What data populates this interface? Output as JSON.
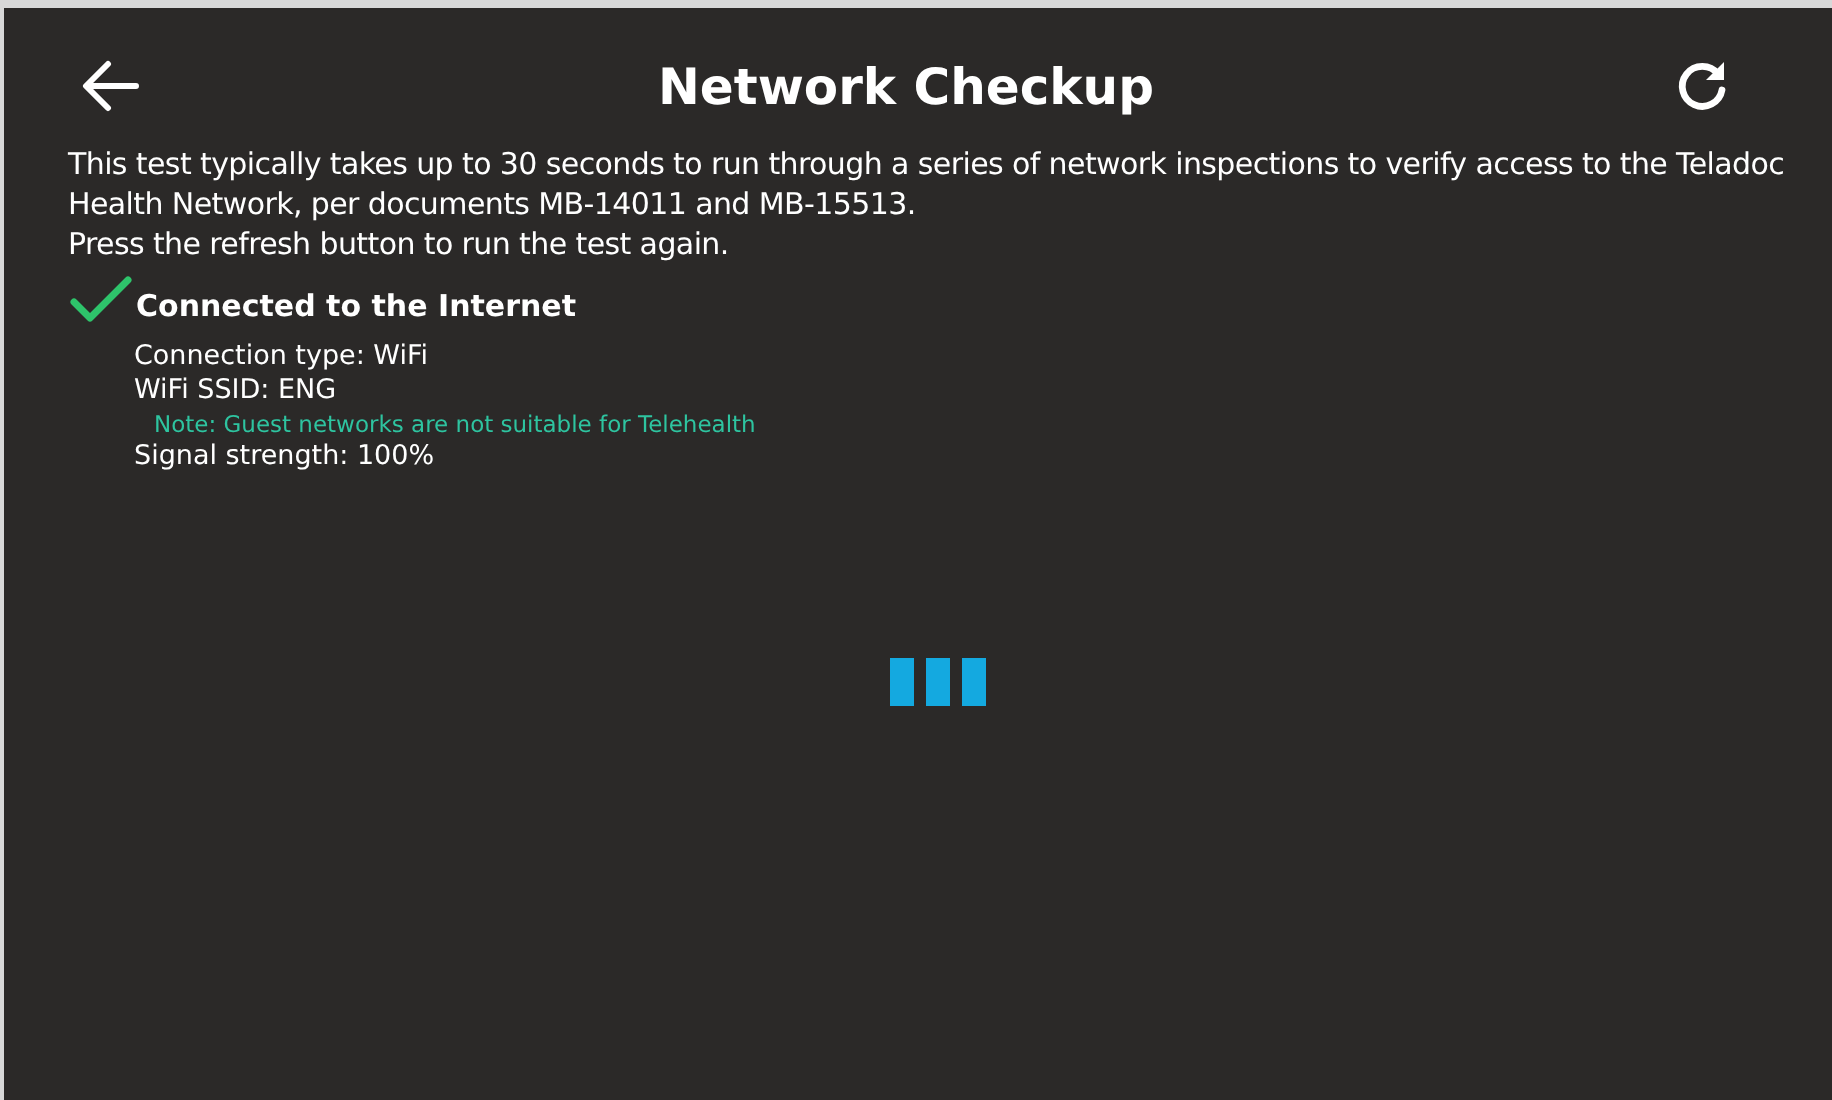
{
  "header": {
    "title": "Network Checkup"
  },
  "intro": [
    "This test typically takes up to 30 seconds to run through a series of network inspections to verify access to the Teladoc Health Network, per documents MB-14011 and MB-15513.",
    "Press the refresh button to run the test again."
  ],
  "checks": [
    {
      "title": "Connected to the Internet",
      "passed": true,
      "details": [
        {
          "kind": "detail",
          "text": "Connection type: WiFi"
        },
        {
          "kind": "detail",
          "text": "WiFi SSID: ENG"
        },
        {
          "kind": "note",
          "text": "Note: Guest networks are not suitable for Telehealth"
        },
        {
          "kind": "detail",
          "text": "Signal strength: 100%"
        }
      ]
    }
  ],
  "loading": true
}
